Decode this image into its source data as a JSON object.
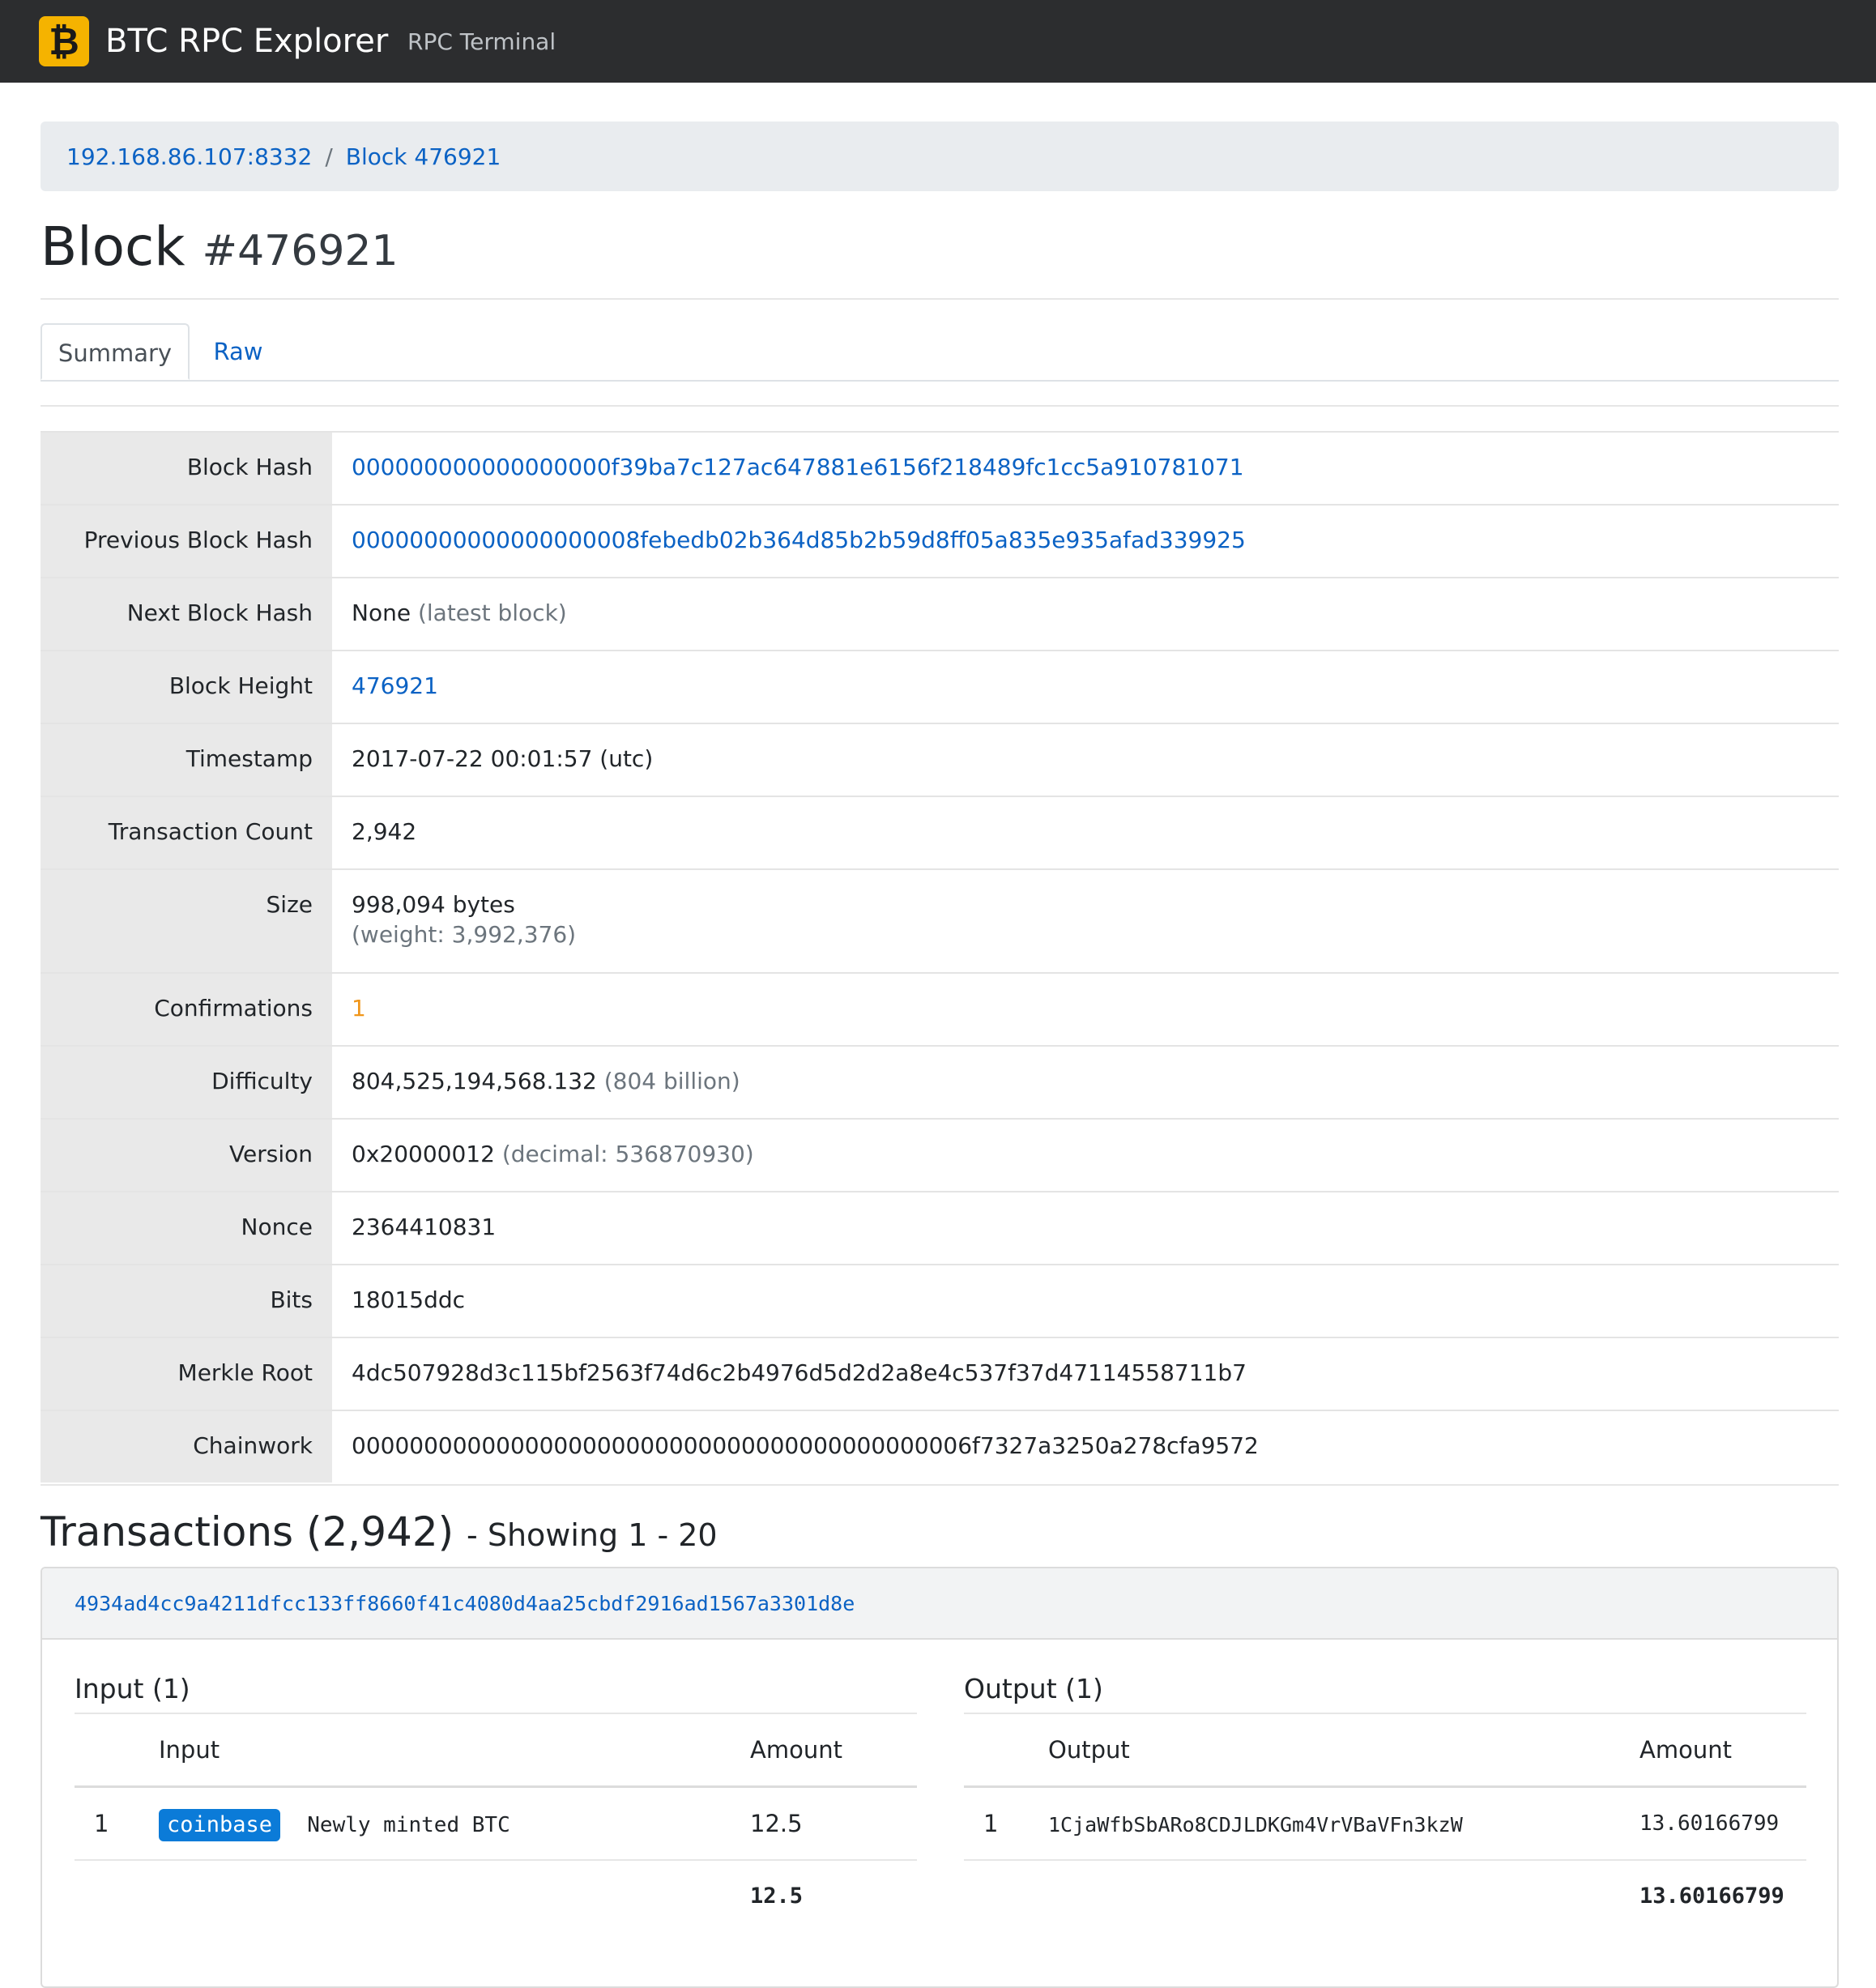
{
  "navbar": {
    "brand_icon": "₿",
    "brand_title": "BTC RPC Explorer",
    "link_rpc_terminal": "RPC Terminal"
  },
  "breadcrumb": {
    "node": "192.168.86.107:8332",
    "separator": "/",
    "current": "Block 476921"
  },
  "page": {
    "title": "Block",
    "block_number": "#476921"
  },
  "tabs": {
    "summary": "Summary",
    "raw": "Raw"
  },
  "summary": {
    "block_hash_label": "Block Hash",
    "block_hash": "000000000000000000f39ba7c127ac647881e6156f218489fc1cc5a910781071",
    "prev_hash_label": "Previous Block Hash",
    "prev_hash": "00000000000000000008febedb02b364d85b2b59d8ff05a835e935afad339925",
    "next_hash_label": "Next Block Hash",
    "next_hash": "None",
    "next_hash_note": "(latest block)",
    "height_label": "Block Height",
    "height": "476921",
    "timestamp_label": "Timestamp",
    "timestamp": "2017-07-22 00:01:57 (utc)",
    "tx_count_label": "Transaction Count",
    "tx_count": "2,942",
    "size_label": "Size",
    "size": "998,094 bytes",
    "weight": "(weight: 3,992,376)",
    "confirmations_label": "Confirmations",
    "confirmations": "1",
    "difficulty_label": "Difficulty",
    "difficulty": "804,525,194,568.132",
    "difficulty_note": "(804 billion)",
    "version_label": "Version",
    "version": "0x20000012",
    "version_note": "(decimal: 536870930)",
    "nonce_label": "Nonce",
    "nonce": "2364410831",
    "bits_label": "Bits",
    "bits": "18015ddc",
    "merkle_label": "Merkle Root",
    "merkle": "4dc507928d3c115bf2563f74d6c2b4976d5d2d2a8e4c537f37d47114558711b7",
    "chainwork_label": "Chainwork",
    "chainwork": "0000000000000000000000000000000000000000006f7327a3250a278cfa9572"
  },
  "transactions": {
    "heading": "Transactions (2,942)",
    "showing": "- Showing 1 - 20",
    "txid": "4934ad4cc9a4211dfcc133ff8660f41c4080d4aa25cbdf2916ad1567a3301d8e",
    "input": {
      "title": "Input (1)",
      "col_input": "Input",
      "col_amount": "Amount",
      "row_num": "1",
      "badge": "coinbase",
      "description": "Newly minted BTC",
      "amount": "12.5",
      "total": "12.5"
    },
    "output": {
      "title": "Output (1)",
      "col_output": "Output",
      "col_amount": "Amount",
      "row_num": "1",
      "address": "1CjaWfbSbARo8CDJLDKGm4VrVBaVFn3kzW",
      "amount": "13.60166799",
      "total": "13.60166799"
    }
  }
}
